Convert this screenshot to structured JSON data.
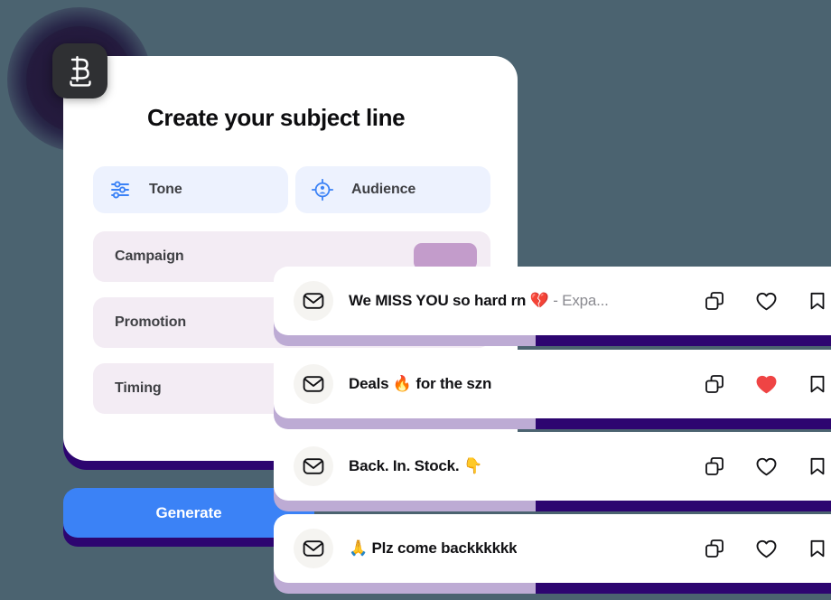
{
  "theme": {
    "background": "#4b6370",
    "accent_blue": "#3b82f6",
    "chip_bg": "#edf2fe",
    "chip_icon": "#3b82f6",
    "option_bg": "#f3ecf4",
    "option_pill": "#c39ccb",
    "shadow_indigo": "#2d0570",
    "shadow_lilac": "#bdabd4",
    "heart_red": "#ef4444",
    "logo_tile": "#2f3033"
  },
  "logo": {
    "name": "brand-logo",
    "glyph": "B"
  },
  "panel": {
    "title": "Create your subject line",
    "chips": [
      {
        "label": "Tone",
        "icon": "sliders-icon"
      },
      {
        "label": "Audience",
        "icon": "target-person-icon"
      }
    ],
    "options": [
      {
        "label": "Campaign",
        "has_pill": true
      },
      {
        "label": "Promotion",
        "has_pill": false
      },
      {
        "label": "Timing",
        "has_pill": false
      }
    ],
    "generate_label": "Generate"
  },
  "results": {
    "items": [
      {
        "icon": "envelope-icon",
        "text": "We MISS YOU so hard rn 💔 ",
        "suffix": "- Expa...",
        "liked": false,
        "actions": [
          "copy-icon",
          "heart-icon",
          "bookmark-icon"
        ]
      },
      {
        "icon": "envelope-icon",
        "text": "Deals 🔥 for the szn",
        "suffix": "",
        "liked": true,
        "actions": [
          "copy-icon",
          "heart-icon",
          "bookmark-icon"
        ]
      },
      {
        "icon": "envelope-icon",
        "text": "Back. In. Stock. 👇",
        "suffix": "",
        "liked": false,
        "actions": [
          "copy-icon",
          "heart-icon",
          "bookmark-icon"
        ]
      },
      {
        "icon": "envelope-icon",
        "text": "🙏 Plz come backkkkkk",
        "suffix": "",
        "liked": false,
        "actions": [
          "copy-icon",
          "heart-icon",
          "bookmark-icon"
        ]
      }
    ]
  }
}
